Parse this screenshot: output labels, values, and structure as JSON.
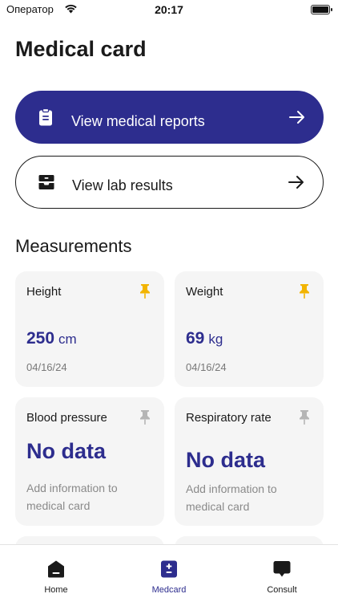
{
  "status_bar": {
    "carrier": "Оператор",
    "time": "20:17"
  },
  "header": {
    "title": "Medical card"
  },
  "actions": [
    {
      "label": "View medical reports",
      "icon": "clipboard-icon"
    },
    {
      "label": "View lab results",
      "icon": "inbox-tray-icon"
    }
  ],
  "measurements": {
    "title": "Measurements",
    "cards": [
      {
        "title": "Height",
        "value": "250",
        "unit": "cm",
        "date": "04/16/24",
        "pinned": true
      },
      {
        "title": "Weight",
        "value": "69",
        "unit": "kg",
        "date": "04/16/24",
        "pinned": true
      },
      {
        "title": "Blood pressure",
        "value": "No data",
        "hint": "Add information to medical card",
        "pinned": false
      },
      {
        "title": "Respiratory rate",
        "value": "No data",
        "hint": "Add information to medical card",
        "pinned": false
      }
    ]
  },
  "tab_bar": {
    "tabs": [
      {
        "label": "Home",
        "icon": "home-icon"
      },
      {
        "label": "Medcard",
        "icon": "medcard-icon",
        "active": true
      },
      {
        "label": "Consult",
        "icon": "chat-bubble-icon"
      }
    ]
  },
  "colors": {
    "accent": "#2d2d8e",
    "pin_active": "#f2b400",
    "pin_inactive": "#b5b5b5",
    "card_bg": "#f5f5f5"
  }
}
